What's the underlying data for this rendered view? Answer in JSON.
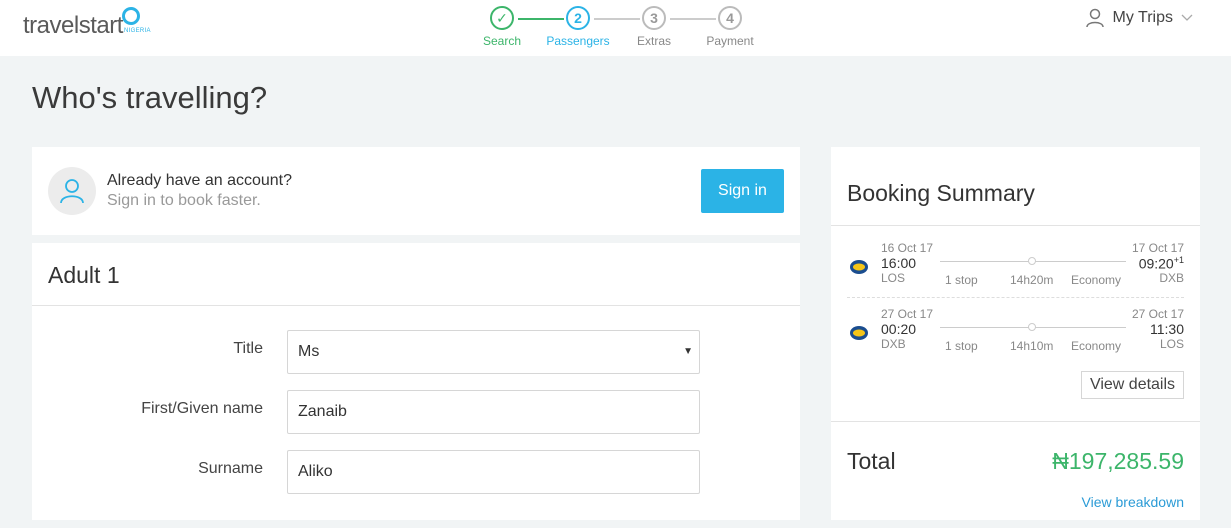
{
  "brand": {
    "name": "travelstart",
    "country": "NIGERIA",
    "accent": "#2bb3e6",
    "success": "#3cb56a"
  },
  "steps": [
    {
      "number": "✓",
      "label": "Search",
      "state": "done"
    },
    {
      "number": "2",
      "label": "Passengers",
      "state": "active"
    },
    {
      "number": "3",
      "label": "Extras",
      "state": "pending"
    },
    {
      "number": "4",
      "label": "Payment",
      "state": "pending"
    }
  ],
  "header": {
    "my_trips": "My Trips",
    "user_icon": "user-icon",
    "chevron_icon": "chevron-down-icon"
  },
  "page": {
    "title": "Who's travelling?"
  },
  "signin": {
    "line1": "Already have an account?",
    "line2": "Sign in to book faster.",
    "button": "Sign in"
  },
  "adult": {
    "title": "Adult 1",
    "fields": {
      "title_label": "Title",
      "title_value": "Ms",
      "first_label": "First/Given name",
      "first_value": "Zanaib",
      "surname_label": "Surname",
      "surname_value": "Aliko"
    }
  },
  "summary": {
    "title": "Booking Summary",
    "flights": [
      {
        "dep_date": "16 Oct 17",
        "dep_time": "16:00",
        "dep_code": "LOS",
        "arr_date": "17 Oct 17",
        "arr_time": "09:20",
        "arr_offset": "+1",
        "arr_code": "DXB",
        "stops": "1 stop",
        "duration": "14h20m",
        "cabin": "Economy"
      },
      {
        "dep_date": "27 Oct 17",
        "dep_time": "00:20",
        "dep_code": "DXB",
        "arr_date": "27 Oct 17",
        "arr_time": "11:30",
        "arr_offset": "",
        "arr_code": "LOS",
        "stops": "1 stop",
        "duration": "14h10m",
        "cabin": "Economy"
      }
    ],
    "view_details": "View details",
    "total_label": "Total",
    "total_value": "₦197,285.59",
    "view_breakdown": "View breakdown"
  }
}
